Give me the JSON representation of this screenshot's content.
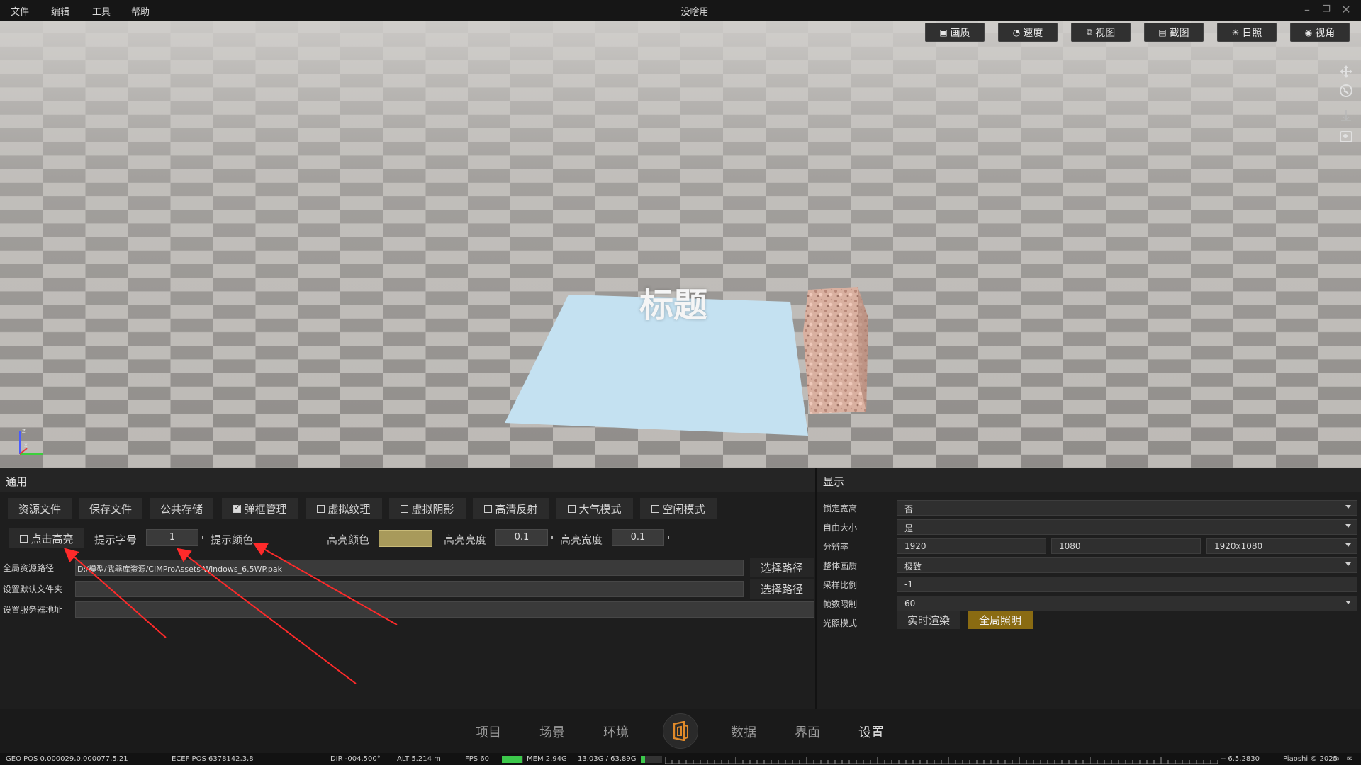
{
  "menu": {
    "file": "文件",
    "edit": "编辑",
    "tools": "工具",
    "help": "帮助"
  },
  "window_title": "没啥用",
  "viewport_toolbar": {
    "quality": "画质",
    "speed": "速度",
    "view": "视图",
    "screenshot": "截图",
    "sunlight": "日照",
    "viewangle": "视角"
  },
  "scene": {
    "title": "标题"
  },
  "general": {
    "header": "通用",
    "tabs": [
      "资源文件",
      "保存文件",
      "公共存储",
      "弹框管理",
      "虚拟纹理",
      "虚拟阴影",
      "高清反射",
      "大气模式",
      "空闲模式"
    ],
    "tab_checked": [
      false,
      false,
      false,
      true,
      false,
      false,
      false,
      false,
      false
    ],
    "click_highlight": "点击高亮",
    "hint_font_label": "提示字号",
    "hint_font_value": "1",
    "hint_color_label": "提示颜色",
    "highlight_color_label": "高亮颜色",
    "highlight_color": "#a89a5b",
    "highlight_brightness_label": "高亮亮度",
    "highlight_brightness_value": "0.1",
    "highlight_width_label": "高亮宽度",
    "highlight_width_value": "0.1",
    "global_path_label": "全局资源路径",
    "global_path_value": "D:/模型/武器库资源/CIMProAssets-Windows_6.5WP.pak",
    "default_folder_label": "设置默认文件夹",
    "default_folder_value": "",
    "server_label": "设置服务器地址",
    "server_value": "",
    "choose_path": "选择路径"
  },
  "display": {
    "header": "显示",
    "lock_aspect_label": "锁定宽高",
    "lock_aspect_value": "否",
    "free_size_label": "自由大小",
    "free_size_value": "是",
    "resolution_label": "分辨率",
    "res_w": "1920",
    "res_h": "1080",
    "res_preset": "1920x1080",
    "overall_quality_label": "整体画质",
    "overall_quality_value": "极致",
    "sampling_label": "采样比例",
    "sampling_value": "-1",
    "fps_limit_label": "帧数限制",
    "fps_limit_value": "60",
    "lighting_label": "光照模式",
    "lighting_realtime": "实时渲染",
    "lighting_global": "全局照明"
  },
  "bottom_nav": [
    "项目",
    "场景",
    "环境",
    "数据",
    "界面",
    "设置"
  ],
  "status": {
    "geo": "GEO POS  0.000029,0.000077,5.21",
    "ecef": "ECEF POS  6378142,3,8",
    "dir": "DIR  -004.500°",
    "alt": "ALT   5.214 m",
    "fps": "FPS   60",
    "mem": "MEM   2.94G",
    "mem_total": "13.03G / 63.89G",
    "version": "--   6.5.2830",
    "copyright": "Piaoshi © 2025"
  },
  "colors": {
    "accent_gold": "#8a6b12",
    "panel_bg": "#1e1e1e",
    "quad": "#c2e0f0",
    "fps_green": "#3cc84b"
  }
}
